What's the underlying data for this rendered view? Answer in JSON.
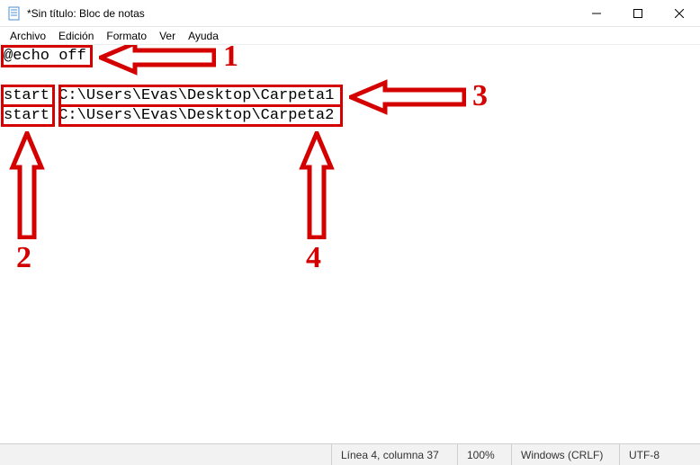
{
  "titlebar": {
    "title": "*Sin título: Bloc de notas"
  },
  "menubar": {
    "items": [
      "Archivo",
      "Edición",
      "Formato",
      "Ver",
      "Ayuda"
    ]
  },
  "editor": {
    "line1": "@echo off",
    "line2_cmd": "start",
    "line2_path": "C:\\Users\\Evas\\Desktop\\Carpeta1",
    "line3_cmd": "start",
    "line3_path": "C:\\Users\\Evas\\Desktop\\Carpeta2",
    "full_text": "@echo off\n\nstart C:\\Users\\Evas\\Desktop\\Carpeta1\nstart C:\\Users\\Evas\\Desktop\\Carpeta2"
  },
  "annotations": {
    "labels": {
      "one": "1",
      "two": "2",
      "three": "3",
      "four": "4"
    },
    "colors": {
      "red": "#d40000"
    }
  },
  "statusbar": {
    "position": "Línea 4, columna 37",
    "zoom": "100%",
    "eol": "Windows (CRLF)",
    "encoding": "UTF-8"
  }
}
